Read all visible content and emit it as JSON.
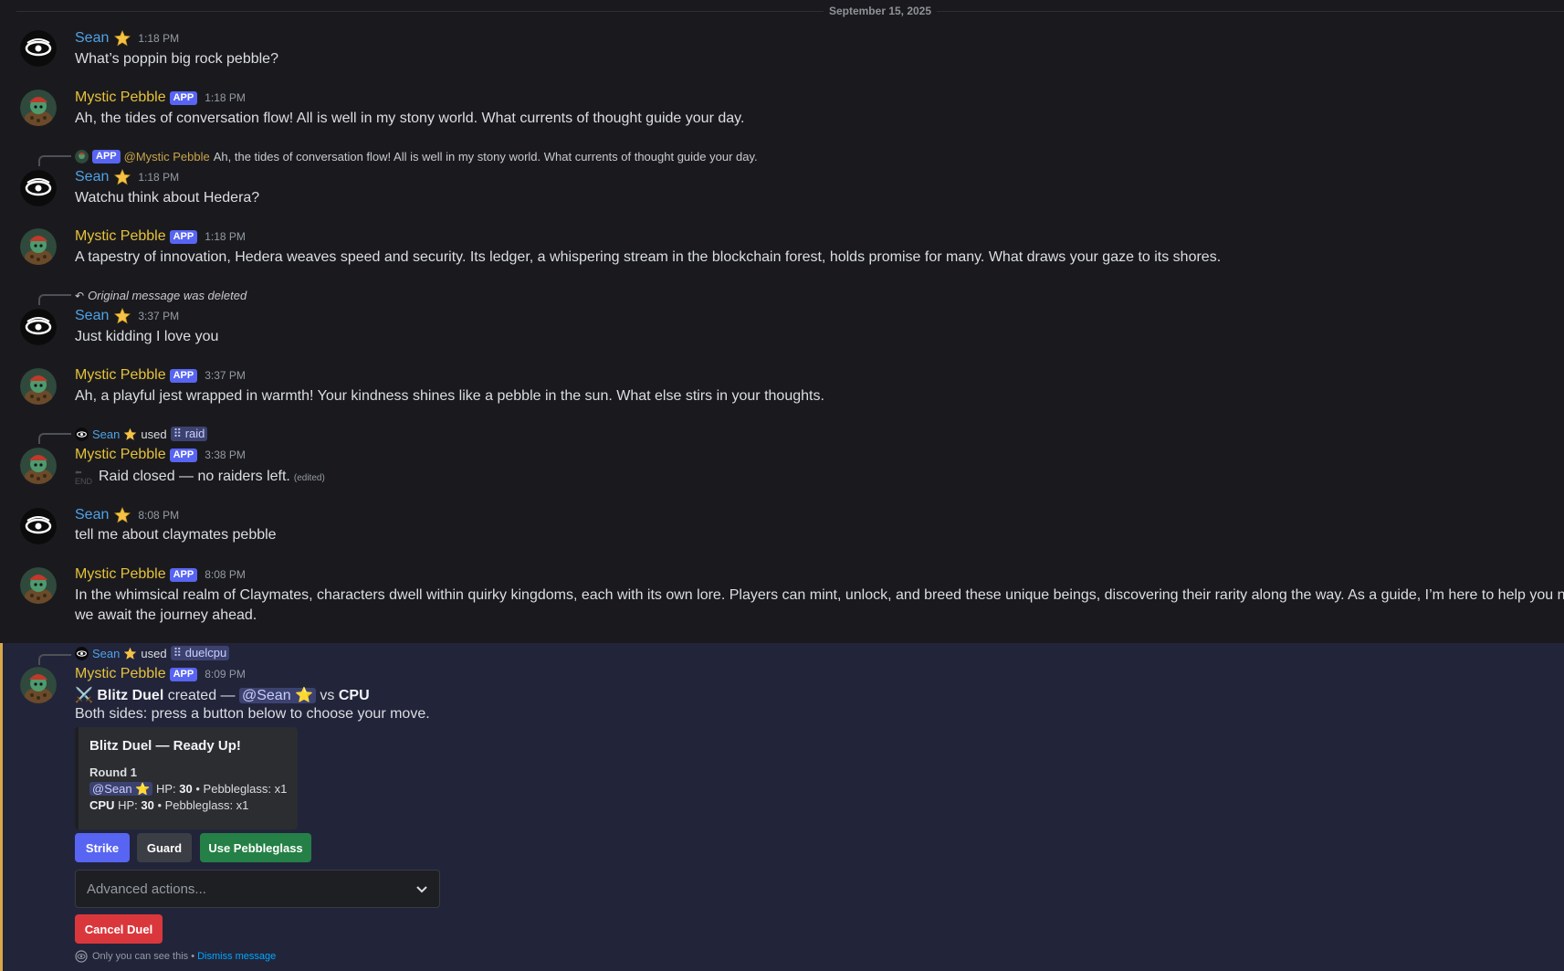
{
  "date_divider": "September 15, 2025",
  "users": {
    "sean": "Sean",
    "bot": "Mystic Pebble",
    "app_tag": "APP"
  },
  "messages": [
    {
      "ts": "1:18 PM",
      "text": "What’s poppin big rock pebble?"
    },
    {
      "ts": "1:18 PM",
      "text": "Ah, the tides of conversation flow! All is well in my stony world. What currents of thought guide your day."
    },
    {
      "reply_mention": "@Mystic Pebble",
      "reply_text": "Ah, the tides of conversation flow! All is well in my stony world. What currents of thought guide your day.",
      "ts": "1:18 PM",
      "text": "Watchu think about Hedera?"
    },
    {
      "ts": "1:18 PM",
      "text": "A tapestry of innovation, Hedera weaves speed and security. Its ledger, a whispering stream in the blockchain forest, holds promise for many. What draws your gaze to its shores."
    },
    {
      "reply_text": "Original message was deleted",
      "ts": "3:37 PM",
      "text": "Just kidding I love you"
    },
    {
      "ts": "3:37 PM",
      "text": "Ah, a playful jest wrapped in warmth! Your kindness shines like a pebble in the sun. What else stirs in your thoughts."
    },
    {
      "reply_used": "used",
      "reply_cmd": "raid",
      "ts": "3:38 PM",
      "text": "Raid closed — no raiders left.",
      "edited": "(edited)",
      "end_icon": "END"
    },
    {
      "ts": "8:08 PM",
      "text": "tell me about claymates pebble"
    },
    {
      "ts": "8:08 PM",
      "text1": "In the whimsical realm of Claymates, characters dwell within quirky kingdoms, each with its own lore. Players can mint, unlock, and breed these unique beings, discovering their rarity along the way. As a guide, I’m here to help you navigate this",
      "text2": "we await the journey ahead."
    },
    {
      "reply_used": "used",
      "reply_cmd": "duelcpu",
      "ts": "8:09 PM",
      "line1": {
        "emoji": "⚔️",
        "title": "Blitz Duel",
        "created": "created —",
        "mention": "@Sean",
        "vs": "vs",
        "cpu": "CPU"
      },
      "line2": "Both sides: press a button below to choose your move."
    }
  ],
  "embed": {
    "title": "Blitz Duel — Ready Up!",
    "round": "Round 1",
    "p1_mention": "@Sean",
    "p1_hp_label": "HP:",
    "p1_hp": "30",
    "p1_rest": "• Pebbleglass: x1",
    "p2_name": "CPU",
    "p2_hp_label": "HP:",
    "p2_hp": "30",
    "p2_rest": "• Pebbleglass: x1"
  },
  "buttons": {
    "strike": "Strike",
    "guard": "Guard",
    "pebbleglass": "Use Pebbleglass",
    "cancel": "Cancel Duel"
  },
  "select": {
    "placeholder": "Advanced actions..."
  },
  "ephemeral": {
    "note": "Only you can see this •",
    "dismiss": "Dismiss message"
  },
  "colors": {
    "sean": "#4fa2e6",
    "bot": "#e6c23a",
    "app": "#5865f2",
    "bg": "#1a1a1e"
  },
  "icons": [
    "sean-eye-avatar",
    "mystic-pebble-avatar",
    "star-badge-icon",
    "chevron-down-icon",
    "eye-icon",
    "reply-arrow-icon",
    "slash-command-icon"
  ]
}
